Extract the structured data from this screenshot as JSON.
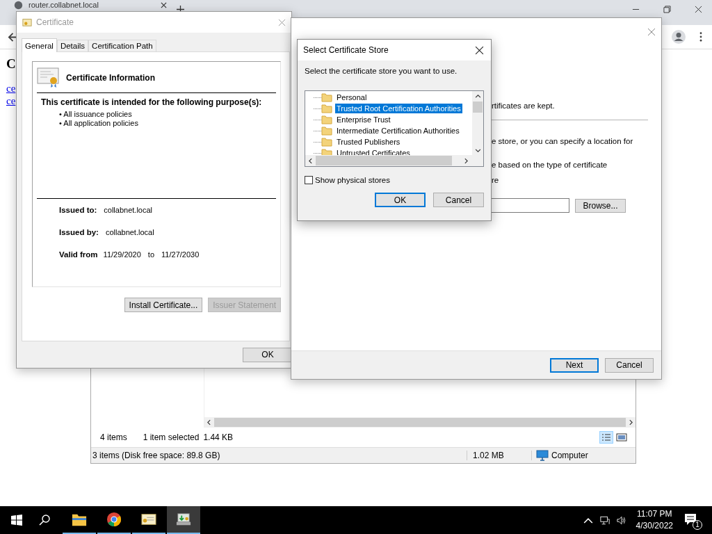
{
  "browser": {
    "tab_title": "router.collabnet.local",
    "page_heading": "C",
    "links": [
      "ce",
      "ce"
    ]
  },
  "certificate_window": {
    "title": "Certificate",
    "tabs": [
      {
        "label": "General",
        "selected": true
      },
      {
        "label": "Details",
        "selected": false
      },
      {
        "label": "Certification Path",
        "selected": false
      }
    ],
    "info_title": "Certificate Information",
    "purpose_heading": "This certificate is intended for the following purpose(s):",
    "purposes": [
      "• All issuance policies",
      "• All application policies"
    ],
    "fields": [
      {
        "label": "Issued to:",
        "value": "collabnet.local"
      },
      {
        "label": "Issued by:",
        "value": "collabnet.local"
      }
    ],
    "validity": {
      "label": "Valid from",
      "from": "11/29/2020",
      "to_label": "to",
      "to": "11/27/2030"
    },
    "buttons": [
      {
        "label": "Install Certificate...",
        "disabled": false
      },
      {
        "label": "Issuer Statement",
        "disabled": true
      }
    ],
    "ok_label": "OK"
  },
  "wizard": {
    "fragments": [
      "rtificates are kept.",
      "e store, or you can specify a location for",
      "e based on the type of certificate",
      "re"
    ],
    "browse_label": "Browse...",
    "buttons": [
      {
        "label": "Next",
        "default": true
      },
      {
        "label": "Cancel",
        "default": false
      }
    ]
  },
  "store_dialog": {
    "title": "Select Certificate Store",
    "prompt": "Select the certificate store you want to use.",
    "stores": [
      {
        "name": "Personal",
        "selected": false
      },
      {
        "name": "Trusted Root Certification Authorities",
        "selected": true
      },
      {
        "name": "Enterprise Trust",
        "selected": false
      },
      {
        "name": "Intermediate Certification Authorities",
        "selected": false
      },
      {
        "name": "Trusted Publishers",
        "selected": false
      },
      {
        "name": "Untrusted Certificates",
        "selected": false
      }
    ],
    "show_physical": {
      "label": "Show physical stores",
      "checked": false
    },
    "buttons": [
      {
        "label": "OK",
        "default": true
      },
      {
        "label": "Cancel",
        "default": false
      }
    ]
  },
  "explorer": {
    "item_count": "4 items",
    "selection": "1 item selected",
    "selection_size": "1.44 KB",
    "status": "3 items (Disk free space: 89.8 GB)",
    "size": "1.02 MB",
    "location": "Computer"
  },
  "taskbar": {
    "apps": [
      {
        "kind": "folder",
        "active": false
      },
      {
        "kind": "browser",
        "active": false
      },
      {
        "kind": "certificate",
        "active": false
      },
      {
        "kind": "installer",
        "active": true
      }
    ],
    "time": "11:07 PM",
    "date": "4/30/2022",
    "notification_count": "1"
  }
}
